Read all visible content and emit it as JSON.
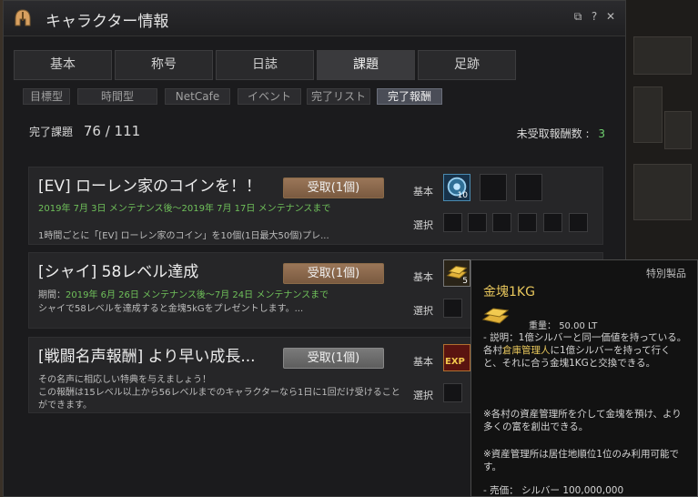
{
  "window": {
    "title": "キャラクター情報",
    "controls": [
      {
        "icon": "restore-icon",
        "glyph": "⧉"
      },
      {
        "icon": "help-icon",
        "glyph": "?"
      },
      {
        "icon": "close-icon",
        "glyph": "✕"
      }
    ]
  },
  "tabs": [
    {
      "label": "基本",
      "active": false
    },
    {
      "label": "称号",
      "active": false
    },
    {
      "label": "日誌",
      "active": false
    },
    {
      "label": "課題",
      "active": true
    },
    {
      "label": "足跡",
      "active": false
    }
  ],
  "subtabs": [
    {
      "label": "目標型",
      "active": false
    },
    {
      "label": "時間型",
      "active": false
    },
    {
      "label": "NetCafe",
      "active": false
    },
    {
      "label": "イベント",
      "active": false
    },
    {
      "label": "完了リスト",
      "active": false
    },
    {
      "label": "完了報酬",
      "active": true
    }
  ],
  "summary": {
    "label": "完了課題",
    "count": "76 / 111"
  },
  "unclaimed": {
    "label": "未受取報酬数",
    "sep": ":",
    "value": "3"
  },
  "labels": {
    "basic": "基本",
    "select": "選択"
  },
  "rewards": [
    {
      "title": "[EV] ローレン家のコインを！！",
      "button": "受取(1個)",
      "period": "2019年 7月 3日 メンテナンス後～2019年 7月 17日 メンテナンスまで",
      "desc": "1時間ごとに「[EV] ローレン家のコイン」を10個(1日最大50個)プレ...",
      "item_icon": "coin-icon",
      "item_qty": "10"
    },
    {
      "title": "[シャイ] 58レベル達成",
      "button": "受取(1個)",
      "period_label": "期間：",
      "period": "2019年 6月 26日 メンテナンス後～7月 24日 メンテナンスまで",
      "desc": "シャイで58レベルを達成すると金塊5kGをプレゼントします。...",
      "item_icon": "gold-bar-icon",
      "item_qty": "5"
    },
    {
      "title": "[戦闘名声報酬] より早い成長...",
      "button": "受取(1個)",
      "desc1": "その名声に相応しい特典を与えましょう！",
      "desc2": "この報酬は15レベル以上から56レベルまでのキャラクターなら1日に1回だけ受けることができます。",
      "item_icon": "exp-icon",
      "item_text": "EXP"
    }
  ],
  "tooltip": {
    "category": "特別製品",
    "name": "金塊1KG",
    "weight_label": "重量：",
    "weight": "50.00 LT",
    "desc_prefix": "- 説明：",
    "desc_1": "1億シルバーと同一価値を持っている。各村",
    "desc_hl": "倉庫管理人",
    "desc_2": "に1億シルバーを持って行くと、それに合う金塊1KGと交換できる。",
    "note": "※各村の資産管理所を介して金塊を預け、より多くの富を創出できる。",
    "note_green": "※資産管理所は居住地順位1位のみ利用可能です。",
    "price_label": "- 売価：",
    "price": "シルバー 100,000,000"
  },
  "colors": {
    "accent_gold": "#e8c75c",
    "green": "#6fc05a",
    "button_brown": "#8a6a4c"
  }
}
